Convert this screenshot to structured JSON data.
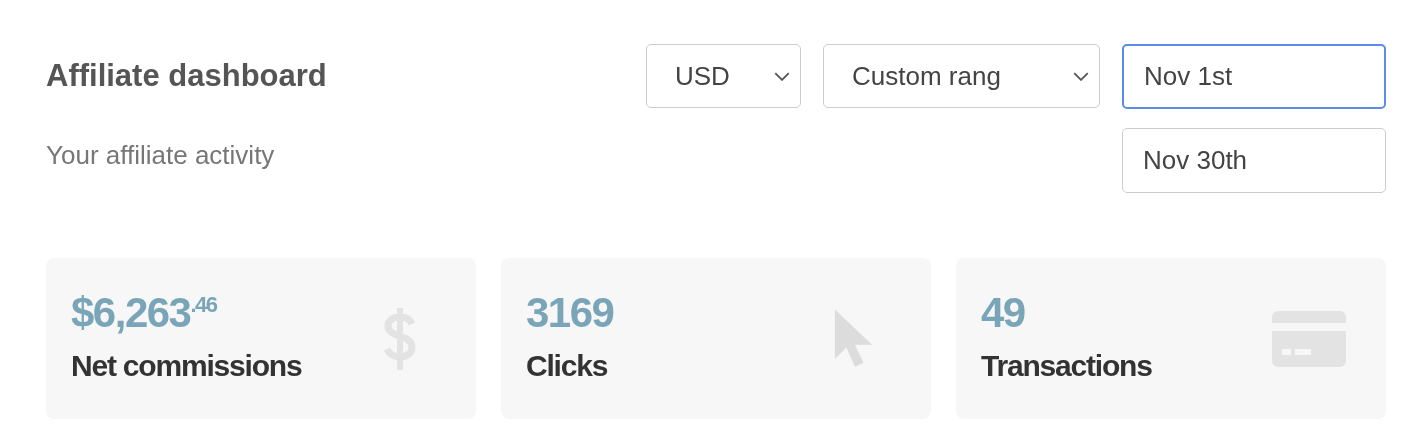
{
  "header": {
    "title": "Affiliate dashboard",
    "subtitle": "Your affiliate activity"
  },
  "controls": {
    "currency": "USD",
    "range": "Custom rang",
    "dates": [
      {
        "value": "Nov 1st",
        "focused": true
      },
      {
        "value": "Nov 30th",
        "focused": false
      }
    ]
  },
  "stats": [
    {
      "kind": "money",
      "value": "$6,263$^{.46}$",
      "label": "Net commissions"
    },
    {
      "kind": "clicks",
      "value": "3169",
      "label": "Clicks"
    },
    {
      "kind": "card",
      "value": "49",
      "label": "Transactions"
    }
  ]
}
